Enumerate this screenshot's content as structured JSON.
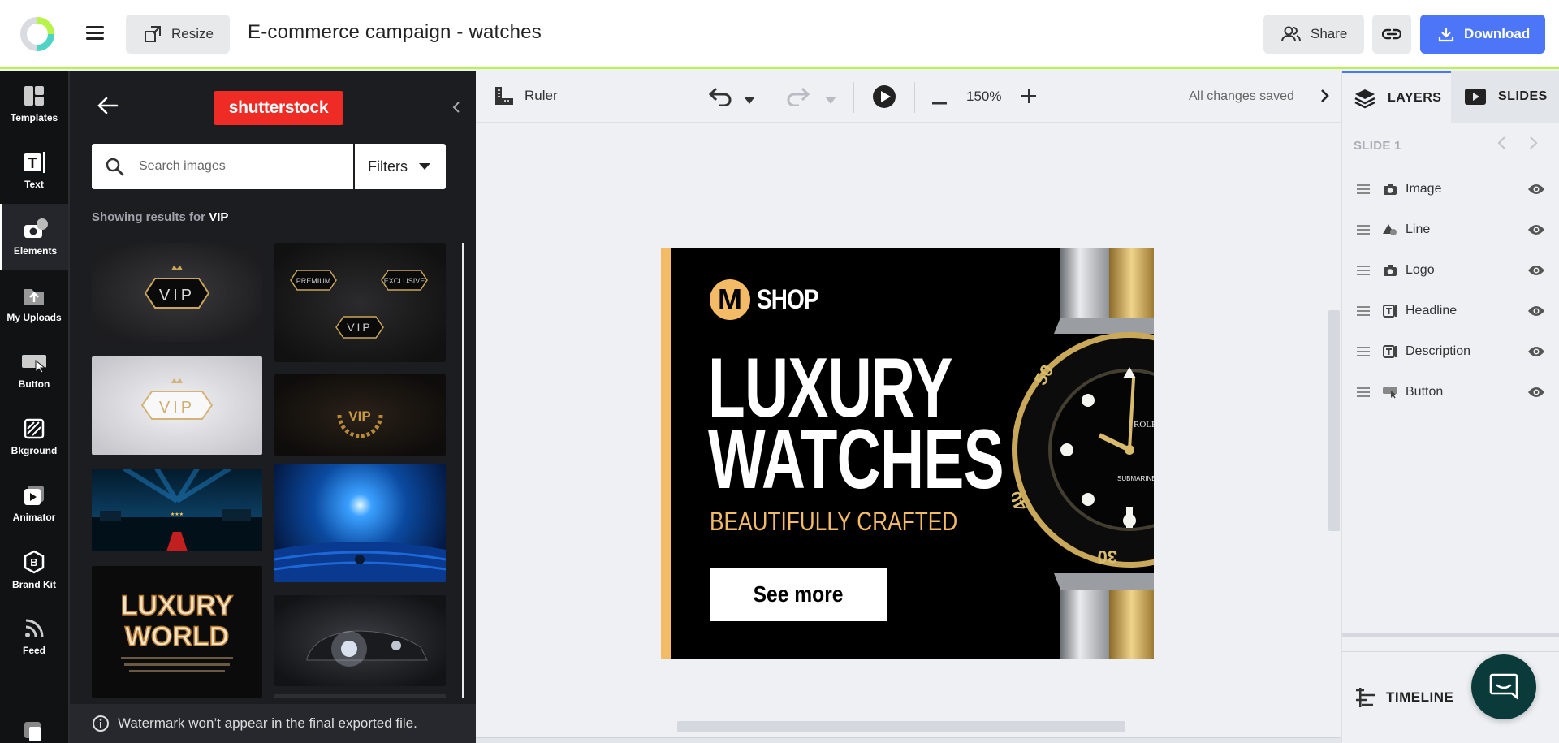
{
  "header": {
    "resize_label": "Resize",
    "title": "E-commerce campaign - watches",
    "share_label": "Share",
    "download_label": "Download"
  },
  "rail": {
    "items": [
      {
        "label": "Templates",
        "icon": "templates-icon"
      },
      {
        "label": "Text",
        "icon": "text-icon"
      },
      {
        "label": "Elements",
        "icon": "elements-icon"
      },
      {
        "label": "My Uploads",
        "icon": "uploads-icon"
      },
      {
        "label": "Button",
        "icon": "button-icon"
      },
      {
        "label": "Bkground",
        "icon": "background-icon"
      },
      {
        "label": "Animator",
        "icon": "animator-icon"
      },
      {
        "label": "Brand Kit",
        "icon": "brand-kit-icon"
      },
      {
        "label": "Feed",
        "icon": "feed-icon"
      }
    ],
    "active": "Elements"
  },
  "panel": {
    "provider_logo": "shutterstock",
    "search_placeholder": "Search images",
    "filters_label": "Filters",
    "results_prefix": "Showing results for",
    "results_query": "VIP",
    "thumb_luxury_line1": "LUXURY",
    "thumb_luxury_line2": "WORLD",
    "thumb_vip": "VIP",
    "thumb_premium": "PREMIUM",
    "thumb_exclusive": "EXCLUSIVE",
    "watermark_note": "Watermark won’t appear in the final exported file."
  },
  "toolbar": {
    "ruler_label": "Ruler",
    "zoom": "150%",
    "save_status": "All changes saved"
  },
  "ad": {
    "logo_letter": "M",
    "logo_text": "SHOP",
    "headline_line1": "LUXURY",
    "headline_line2": "WATCHES",
    "description": "BEAUTIFULLY CRAFTED",
    "button_label": "See more",
    "accent_color": "#f4bb66",
    "watch_brand": "ROLEX",
    "watch_model": "SUBMARINER",
    "bezel_50": "50",
    "bezel_40": "40",
    "bezel_30": "30"
  },
  "right_panel": {
    "tab_layers": "LAYERS",
    "tab_slides": "SLIDES",
    "slide_label": "SLIDE 1",
    "layers": [
      {
        "name": "Image",
        "type": "image-icon"
      },
      {
        "name": "Line",
        "type": "shape-icon"
      },
      {
        "name": "Logo",
        "type": "image-icon"
      },
      {
        "name": "Headline",
        "type": "text-icon"
      },
      {
        "name": "Description",
        "type": "text-icon"
      },
      {
        "name": "Button",
        "type": "button-icon"
      }
    ],
    "timeline_label": "TIMELINE"
  },
  "colors": {
    "accent_blue": "#4c76f7",
    "highlight_green": "#b7f34a",
    "shutterstock_red": "#ee2b24"
  }
}
